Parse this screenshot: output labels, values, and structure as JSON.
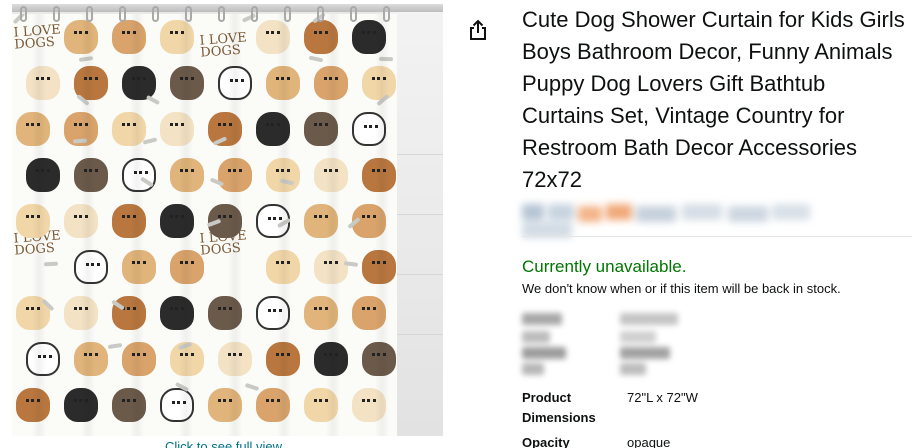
{
  "product": {
    "title": "Cute Dog Shower Curtain for Kids Girls Boys Bathroom Decor, Funny Animals Puppy Dog Lovers Gift Bathtub Curtains Set, Vintage Country for Restroom Bath Decor Accessories 72x72"
  },
  "image": {
    "print_text_1": "I LOVE",
    "print_text_2": "DOGS",
    "click_hint": "Click to see full view"
  },
  "share": {
    "icon": "share-icon"
  },
  "availability": {
    "status": "Currently unavailable.",
    "message": "We don't know when or if this item will be back in stock."
  },
  "specs": [
    {
      "label": "Product Dimensions",
      "value": "72\"L x 72\"W"
    },
    {
      "label": "Opacity",
      "value": "opaque"
    }
  ],
  "colors": {
    "availability_green": "#007600",
    "link_teal": "#007185",
    "text": "#0f1111"
  }
}
